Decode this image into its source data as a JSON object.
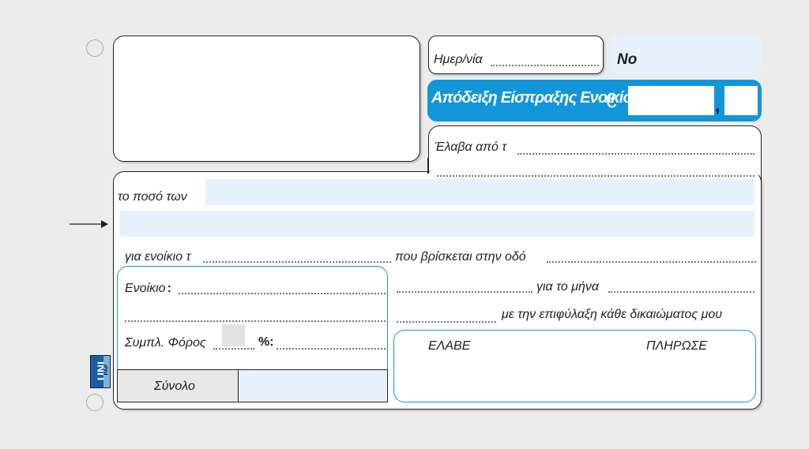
{
  "header": {
    "date_label": "Ημερ/νία",
    "number_label": "No",
    "title": "Απόδειξη Είσπραξης Ενοικίου",
    "currency_symbol": "€",
    "decimal_separator": ","
  },
  "received_from": {
    "label": "Έλαβα από τ"
  },
  "body": {
    "amount_label": "το ποσό των",
    "rent_for_label": "για ενοίκιο τ",
    "located_label": "που βρίσκεται στην οδό",
    "month_label": "για το μήνα",
    "reservation_label": "με την επιφύλαξη κάθε δικαιώματος μου"
  },
  "breakdown": {
    "rent_label": "Ενοίκιο",
    "rent_colon": ":",
    "stamp_label": "Συμπλ. Φόρος",
    "percent_label": "%:",
    "total_label": "Σύνολο"
  },
  "signatures": {
    "received_label": "ΕΛΑΒΕ",
    "paid_label": "ΠΛΗΡΩΣΕ"
  },
  "brand": {
    "logo_text": "UNI",
    "logo_sub": "PAP"
  },
  "colors": {
    "accent": "#1396d9",
    "light_fill": "#e6f1fc",
    "border": "#222222"
  }
}
